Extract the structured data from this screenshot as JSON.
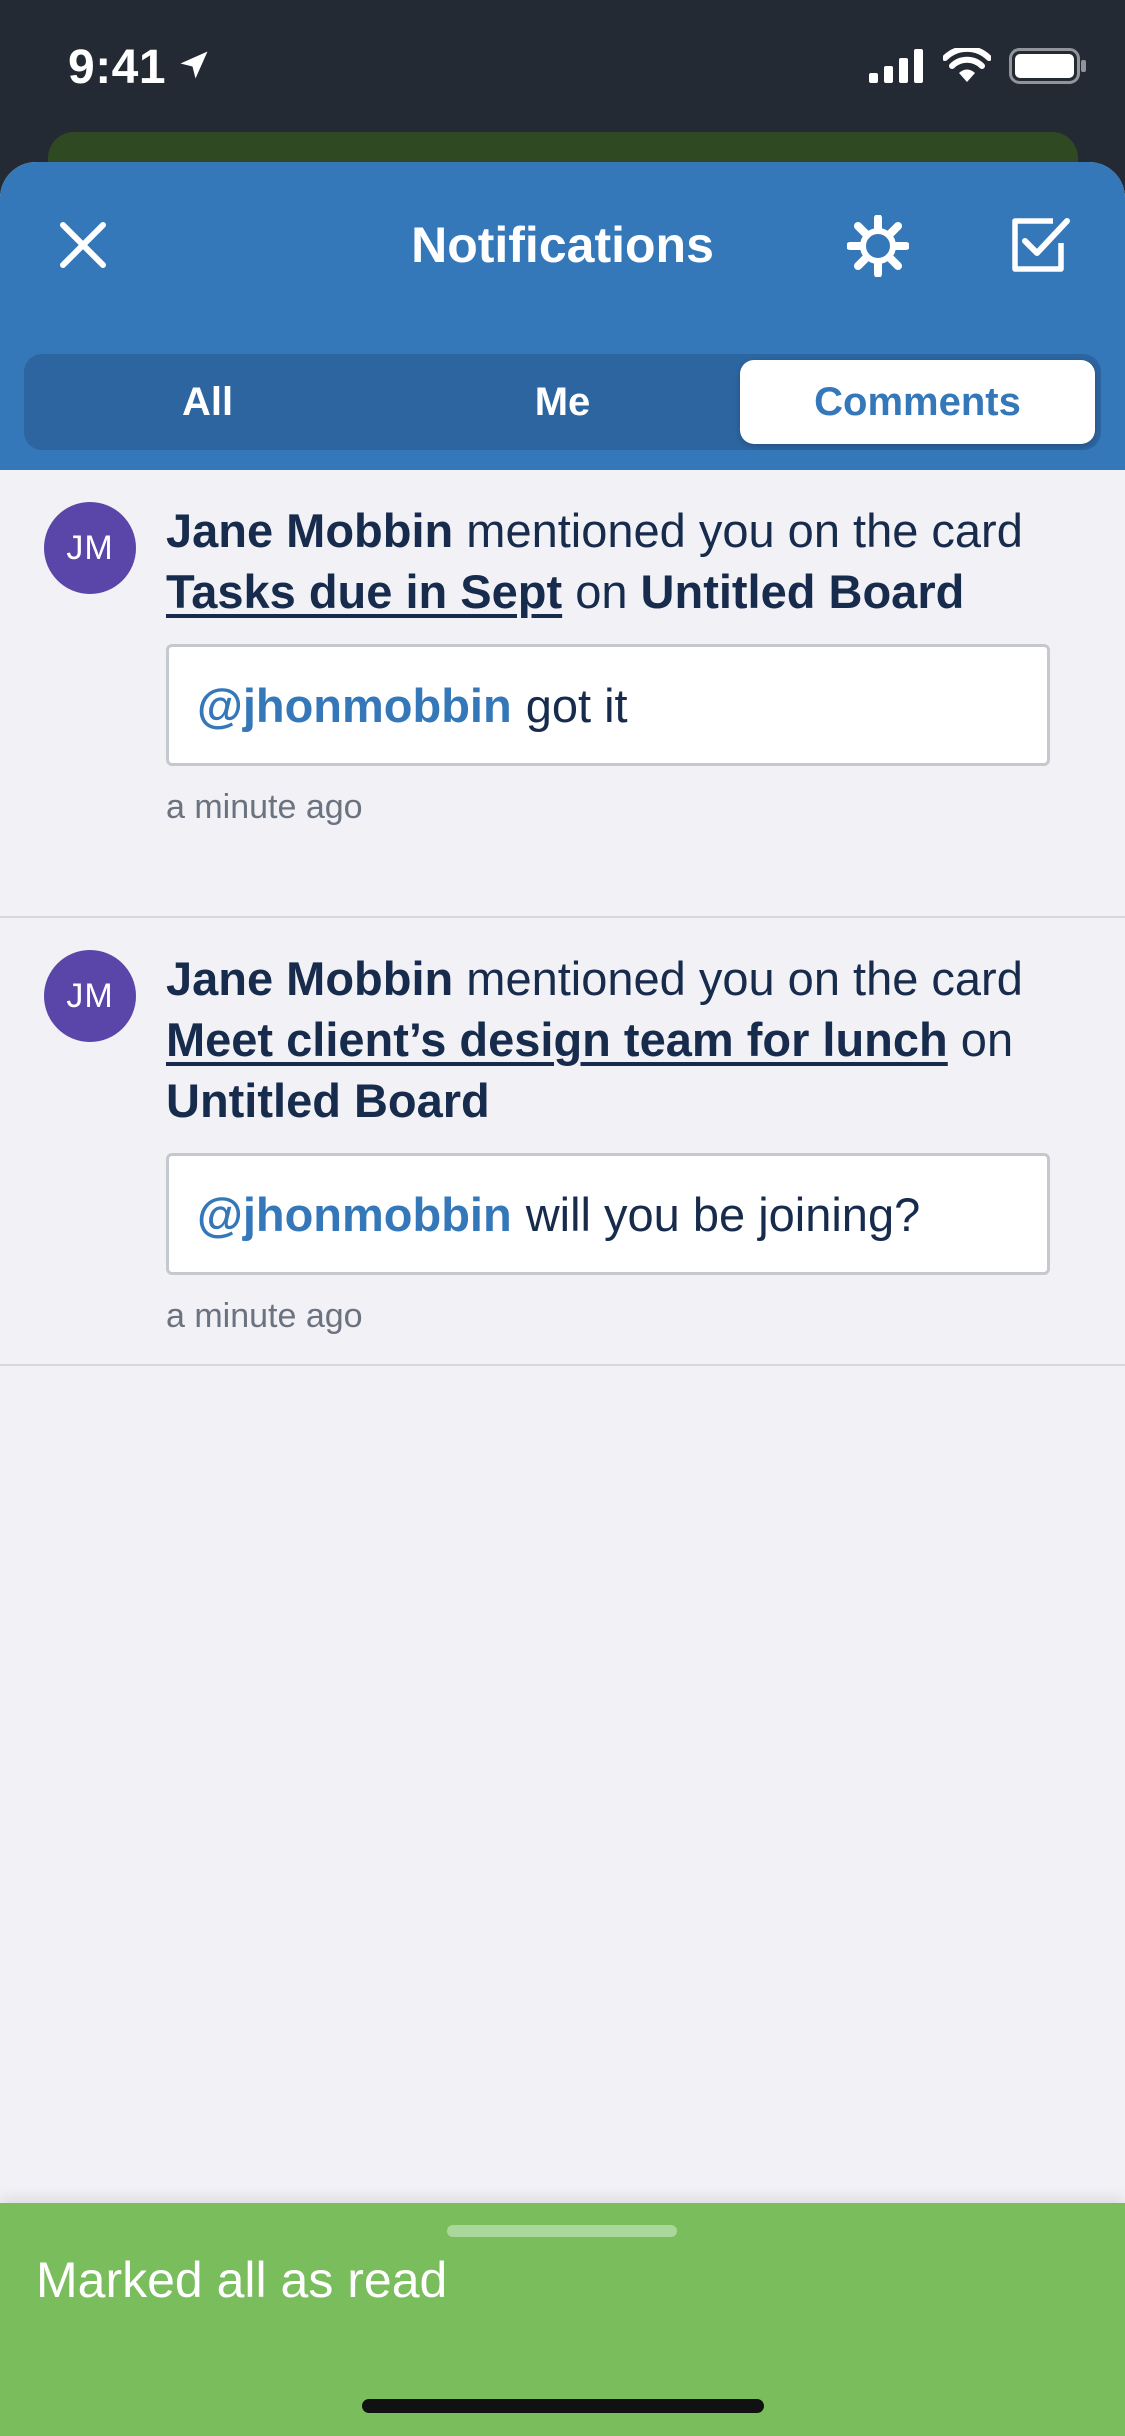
{
  "status_bar": {
    "time": "9:41"
  },
  "header": {
    "title": "Notifications"
  },
  "tabs": [
    {
      "label": "All",
      "active": false
    },
    {
      "label": "Me",
      "active": false
    },
    {
      "label": "Comments",
      "active": true
    }
  ],
  "notifications": [
    {
      "avatar_initials": "JM",
      "author": "Jane Mobbin",
      "text_mid": " mentioned you on the card ",
      "card_link": "Tasks due in Sept",
      "text_on": " on ",
      "board": "Untitled Board",
      "mention": "@jhonmobbin",
      "comment": "got it",
      "time": "a minute ago"
    },
    {
      "avatar_initials": "JM",
      "author": "Jane Mobbin",
      "text_mid": " mentioned you on the card ",
      "card_link": "Meet client’s design team for lunch",
      "text_on": " on ",
      "board": "Untitled Board",
      "mention": "@jhonmobbin",
      "comment": "will you be joining?",
      "time": "a minute ago"
    }
  ],
  "toast": {
    "message": "Marked all as read"
  },
  "colors": {
    "header_blue": "#3478b9",
    "avatar_purple": "#5a46a8",
    "toast_green": "#7abd5d",
    "text_dark": "#172b4d"
  }
}
